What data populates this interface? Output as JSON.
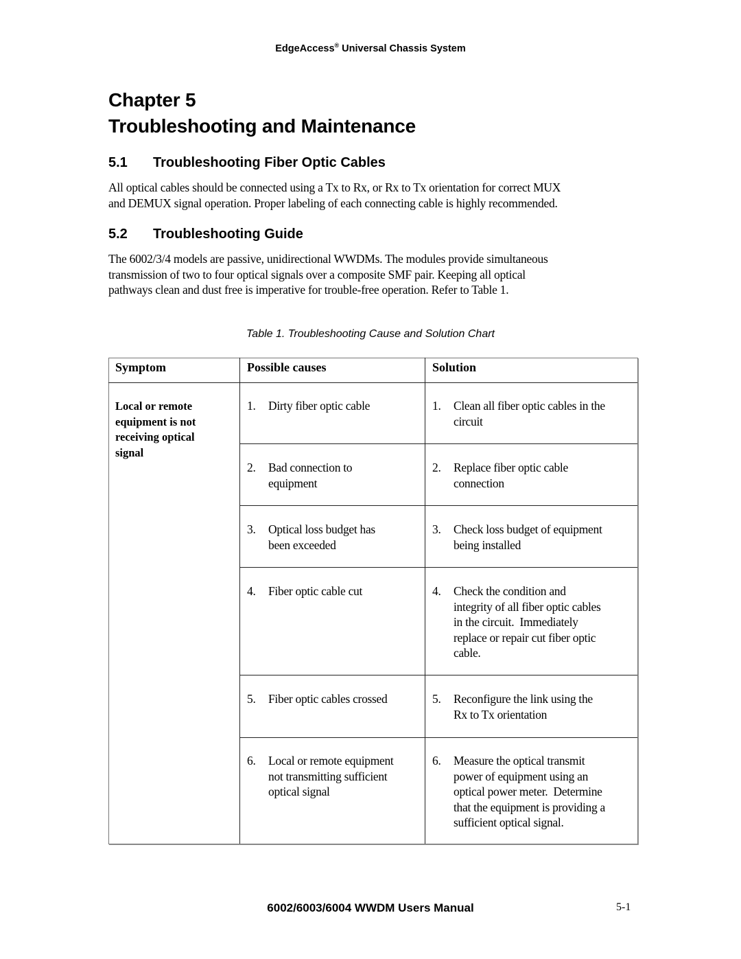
{
  "header": {
    "brand": "EdgeAccess",
    "registered_mark": "®",
    "rest": " Universal Chassis System"
  },
  "chapter": {
    "line1": "Chapter 5",
    "line2": "Troubleshooting and Maintenance"
  },
  "sections": [
    {
      "number": "5.1",
      "title": "Troubleshooting Fiber Optic Cables",
      "paragraph_lines": [
        "All optical cables should be connected using a Tx to Rx, or Rx to Tx orientation for correct MUX",
        "and DEMUX signal operation. Proper labeling of each connecting cable is highly recommended."
      ]
    },
    {
      "number": "5.2",
      "title": "Troubleshooting Guide",
      "paragraph_lines": [
        "The 6002/3/4 models are passive, unidirectional WWDMs. The modules provide simultaneous",
        "transmission of two to four optical signals over a composite SMF pair. Keeping all optical",
        "pathways clean and dust free is imperative for trouble-free operation. Refer to Table 1."
      ]
    }
  ],
  "table": {
    "caption": "Table 1. Troubleshooting Cause and Solution Chart",
    "headers": [
      "Symptom",
      "Possible causes",
      "Solution"
    ],
    "symptom_lines": [
      "Local or remote",
      "equipment is not",
      "receiving optical",
      "signal"
    ],
    "rows": [
      {
        "number": "1.",
        "cause_lines": [
          "Dirty fiber optic cable"
        ],
        "solution_lines": [
          "Clean all fiber optic cables in the",
          "circuit"
        ]
      },
      {
        "number": "2.",
        "cause_lines": [
          "Bad connection to",
          "equipment"
        ],
        "solution_lines": [
          "Replace fiber optic cable",
          "connection"
        ]
      },
      {
        "number": "3.",
        "cause_lines": [
          "Optical loss budget has",
          "been exceeded"
        ],
        "solution_lines": [
          "Check loss budget of equipment",
          "being installed"
        ]
      },
      {
        "number": "4.",
        "cause_lines": [
          "Fiber optic cable cut"
        ],
        "solution_lines": [
          "Check the condition and",
          "integrity of all fiber optic cables",
          "in the circuit.  Immediately",
          "replace or repair cut fiber optic",
          "cable."
        ]
      },
      {
        "number": "5.",
        "cause_lines": [
          "Fiber optic cables crossed"
        ],
        "solution_lines": [
          "Reconfigure the link using the",
          "Rx to Tx orientation"
        ]
      },
      {
        "number": "6.",
        "cause_lines": [
          "Local or remote equipment",
          "not transmitting sufficient",
          "optical signal"
        ],
        "solution_lines": [
          "Measure the optical transmit",
          "power of equipment using an",
          "optical power meter.  Determine",
          "that the equipment is providing a",
          "sufficient optical signal."
        ]
      }
    ]
  },
  "footer": {
    "manual_title": "6002/6003/6004 WWDM Users Manual",
    "page_number": "5-1"
  }
}
